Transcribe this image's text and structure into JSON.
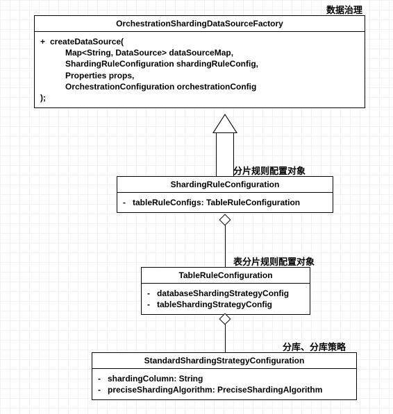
{
  "labels": {
    "l1": "数据治理",
    "l2": "分片规则配置对象",
    "l3": "表分片规则配置对象",
    "l4": "分库、分库策略"
  },
  "box1": {
    "title": "OrchestrationShardingDataSourceFactory",
    "vis": "+",
    "method_open": "createDataSource(",
    "arg1": "Map<String, DataSource> dataSourceMap,",
    "arg2": "ShardingRuleConfiguration shardingRuleConfig,",
    "arg3": "Properties props,",
    "arg4": "OrchestrationConfiguration orchestrationConfig",
    "method_close": ");"
  },
  "box2": {
    "title": "ShardingRuleConfiguration",
    "vis": "-",
    "attr1": "tableRuleConfigs: TableRuleConfiguration"
  },
  "box3": {
    "title": "TableRuleConfiguration",
    "vis1": "-",
    "attr1": "databaseShardingStrategyConfig",
    "vis2": "-",
    "attr2": "tableShardingStrategyConfig"
  },
  "box4": {
    "title": "StandardShardingStrategyConfiguration",
    "vis1": "-",
    "attr1": "shardingColumn: String",
    "vis2": "-",
    "attr2": "preciseShardingAlgorithm: PreciseShardingAlgorithm"
  },
  "chart_data": {
    "type": "uml-class-diagram",
    "classes": [
      {
        "name": "OrchestrationShardingDataSourceFactory",
        "stereotype_label": "数据治理",
        "methods": [
          {
            "visibility": "+",
            "name": "createDataSource",
            "params": [
              "Map<String, DataSource> dataSourceMap",
              "ShardingRuleConfiguration shardingRuleConfig",
              "Properties props",
              "OrchestrationConfiguration orchestrationConfig"
            ]
          }
        ]
      },
      {
        "name": "ShardingRuleConfiguration",
        "stereotype_label": "分片规则配置对象",
        "attributes": [
          {
            "visibility": "-",
            "name": "tableRuleConfigs",
            "type": "TableRuleConfiguration"
          }
        ]
      },
      {
        "name": "TableRuleConfiguration",
        "stereotype_label": "表分片规则配置对象",
        "attributes": [
          {
            "visibility": "-",
            "name": "databaseShardingStrategyConfig"
          },
          {
            "visibility": "-",
            "name": "tableShardingStrategyConfig"
          }
        ]
      },
      {
        "name": "StandardShardingStrategyConfiguration",
        "stereotype_label": "分库、分库策略",
        "attributes": [
          {
            "visibility": "-",
            "name": "shardingColumn",
            "type": "String"
          },
          {
            "visibility": "-",
            "name": "preciseShardingAlgorithm",
            "type": "PreciseShardingAlgorithm"
          }
        ]
      }
    ],
    "relations": [
      {
        "from": "ShardingRuleConfiguration",
        "to": "OrchestrationShardingDataSourceFactory",
        "kind": "generalization"
      },
      {
        "from": "TableRuleConfiguration",
        "to": "ShardingRuleConfiguration",
        "kind": "aggregation"
      },
      {
        "from": "StandardShardingStrategyConfiguration",
        "to": "TableRuleConfiguration",
        "kind": "aggregation"
      }
    ]
  }
}
